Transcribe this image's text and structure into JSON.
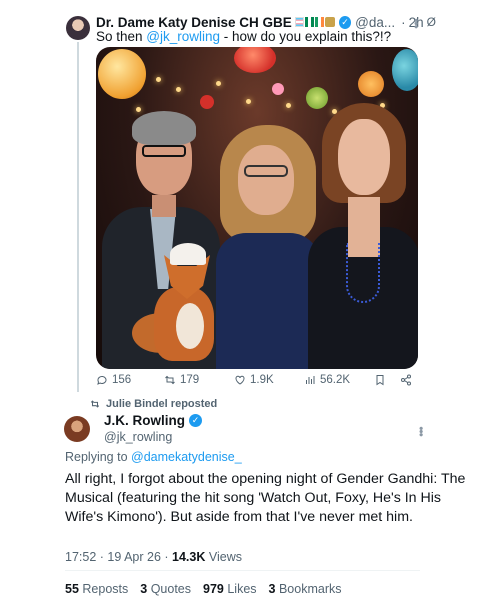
{
  "quoted_tweet": {
    "display_name": "Dr. Dame Katy Denise CH GBE",
    "handle": "@da...",
    "separator": "·",
    "time": "2h",
    "edited_icon": "Ø",
    "text_prefix": "So then ",
    "mention": "@jk_rowling",
    "text_suffix": " - how do you explain this?!?",
    "actions": {
      "replies": "156",
      "reposts": "179",
      "likes": "1.9K",
      "views": "56.2K"
    }
  },
  "repost_line": "Julie Bindel reposted",
  "main_tweet": {
    "display_name": "J.K. Rowling",
    "handle": "@jk_rowling",
    "replying_prefix": "Replying to ",
    "replying_to": "@damekatydenise_",
    "text": "All right, I forgot about the opening night of Gender Gandhi: The Musical (featuring the hit song 'Watch Out, Foxy, He's In His Wife's Kimono'). But aside from that I've never met him.",
    "time": "17:52 · 19 Apr 26 · ",
    "views_count": "14.3K",
    "views_label": " Views",
    "stats": {
      "reposts_count": "55",
      "reposts_label": "Reposts",
      "quotes_count": "3",
      "quotes_label": "Quotes",
      "likes_count": "979",
      "likes_label": "Likes",
      "bookmarks_count": "3",
      "bookmarks_label": "Bookmarks"
    }
  },
  "colors": {
    "accent": "#1d9bf0",
    "text": "#0f1419",
    "muted": "#536471"
  }
}
